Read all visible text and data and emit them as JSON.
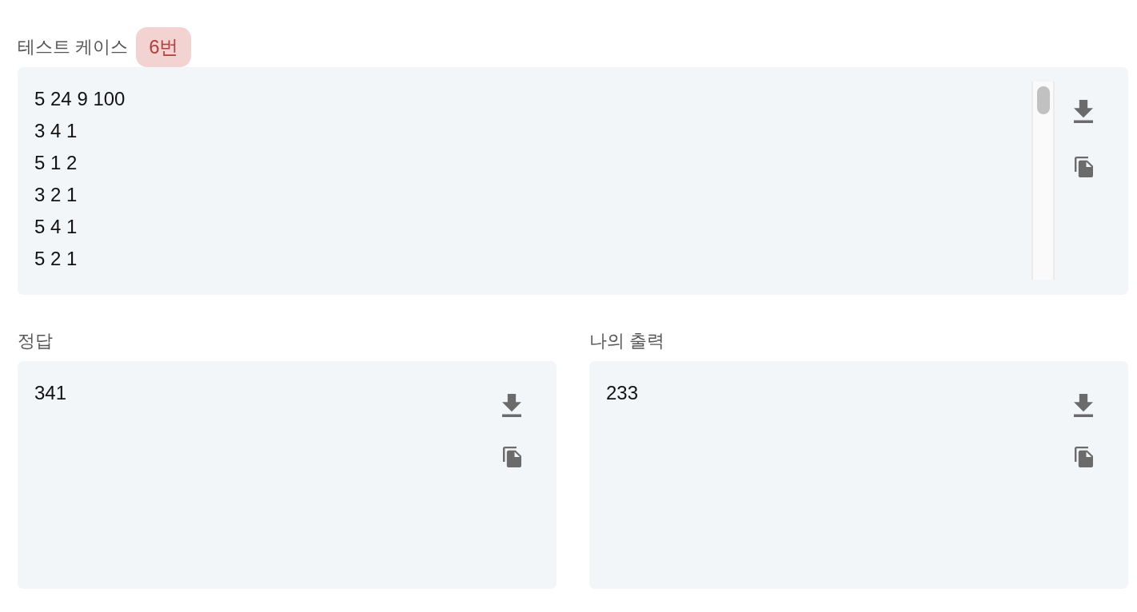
{
  "test_case": {
    "label": "테스트 케이스",
    "badge": "6번",
    "lines": [
      "5 24 9 100",
      "3 4 1",
      "5 1 2",
      "3 2 1",
      "5 4 1",
      "5 2 1"
    ]
  },
  "results": [
    {
      "label": "정답",
      "lines": [
        "341"
      ]
    },
    {
      "label": "나의 출력",
      "lines": [
        "233"
      ]
    }
  ]
}
